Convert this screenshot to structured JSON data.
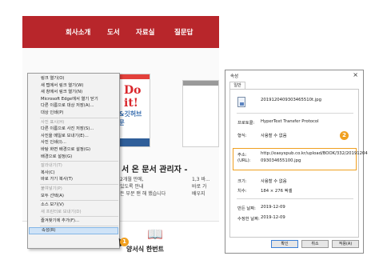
{
  "webpage": {
    "nav": [
      "회사소개",
      "도서",
      "자료실",
      "질문답"
    ],
    "book_badge": "Do it!",
    "book_subtitle": "깃&깃허브 입문",
    "book_title": "서 온 문서 관리자 -",
    "desc_lines": [
      "2개월 만에,",
      "있도록 안내",
      "든 부분 맨 해 했습니다"
    ],
    "desc_right": [
      "1,3 바...",
      "바로 가",
      "배우지"
    ],
    "bottom_caption": "양서식 한번트"
  },
  "context_menu": {
    "items": [
      {
        "label": "링크 열기(O)",
        "disabled": false
      },
      {
        "label": "새 탭에서 링크 열기(W)",
        "disabled": false
      },
      {
        "label": "새 창에서 링크 열기(N)",
        "disabled": false
      },
      {
        "label": "Microsoft Edge에서 열기 닫기",
        "disabled": false
      },
      {
        "label": "다른 이름으로 대상 저장(A)...",
        "disabled": false
      },
      {
        "label": "대상 인쇄(P)",
        "disabled": false
      },
      {
        "label": "사진 표시(H)",
        "disabled": true
      },
      {
        "label": "다른 이름으로 사진 저장(S)...",
        "disabled": false
      },
      {
        "label": "사진을 메일로 보내기(E)...",
        "disabled": false
      },
      {
        "label": "사진 인쇄(I)...",
        "disabled": false
      },
      {
        "label": "바탕 화면 배경으로 설정(G)",
        "disabled": false
      },
      {
        "label": "배경으로 설정(G)",
        "disabled": false
      },
      {
        "label": "잘라내기(T)",
        "disabled": true
      },
      {
        "label": "복사(C)",
        "disabled": false
      },
      {
        "label": "바로 가기 복사(T)",
        "disabled": false
      },
      {
        "label": "붙여넣기(P)",
        "disabled": true
      },
      {
        "label": "모두 선택(A)",
        "disabled": false
      },
      {
        "label": "소스 보기(V)",
        "disabled": false
      },
      {
        "label": "새 프린터로 보내기(D)",
        "disabled": true
      },
      {
        "label": "즐겨찾기에 추가(F)...",
        "disabled": false
      },
      {
        "label": "속성(R)",
        "disabled": false
      }
    ],
    "selected_index": 20
  },
  "badges": {
    "left": "1",
    "right": "2"
  },
  "dialog": {
    "title": "속성",
    "close": "×",
    "tab": "일반",
    "filename": "2019120409303465510t.jpg",
    "rows": [
      {
        "label": "프로토콜:",
        "value": "HyperText Transfer Protocol"
      },
      {
        "label": "형식:",
        "value": "사용할 수 없음"
      },
      {
        "label": "주소:",
        "value": "http://easyspub.co.kr/upload/BOOK/332/20191204"
      },
      {
        "label": "(URL):",
        "value": "093034655100.jpg"
      },
      {
        "label": "크기:",
        "value": "사용할 수 없음"
      },
      {
        "label": "치수:",
        "value": "184 × 276 픽셀"
      },
      {
        "label": "만든 날짜:",
        "value": "2019-12-09"
      },
      {
        "label": "수정한 날짜:",
        "value": "2019-12-09"
      }
    ],
    "buttons": {
      "ok": "확인",
      "cancel": "취소",
      "apply": "적용(A)"
    }
  },
  "colors": {
    "nav_red": "#b8262b",
    "highlight_orange": "#f0a020",
    "selection_blue": "#cfe3f7"
  }
}
